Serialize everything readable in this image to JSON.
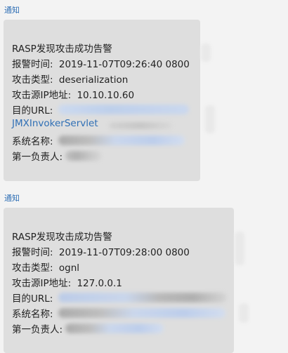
{
  "messages": [
    {
      "sender": "通知",
      "title": "RASP发现攻击成功告警",
      "alert_time_label": "报警时间:",
      "alert_time_value": "2019-11-07T09:26:40 0800",
      "attack_type_label": "攻击类型:",
      "attack_type_value": "deserialization",
      "source_ip_label": "攻击源IP地址:",
      "source_ip_value": "10.10.10.60",
      "target_url_label": "目的URL:",
      "target_url_link": "JMXInvokerServlet",
      "system_name_label": "系统名称:",
      "owner_label": "第一负责人:"
    },
    {
      "sender": "通知",
      "title": "RASP发现攻击成功告警",
      "alert_time_label": "报警时间:",
      "alert_time_value": "2019-11-07T09:28:00 0800",
      "attack_type_label": "攻击类型:",
      "attack_type_value": "ognl",
      "source_ip_label": "攻击源IP地址:",
      "source_ip_value": "127.0.0.1",
      "target_url_label": "目的URL:",
      "system_name_label": "系统名称:",
      "owner_label": "第一负责人:"
    }
  ]
}
